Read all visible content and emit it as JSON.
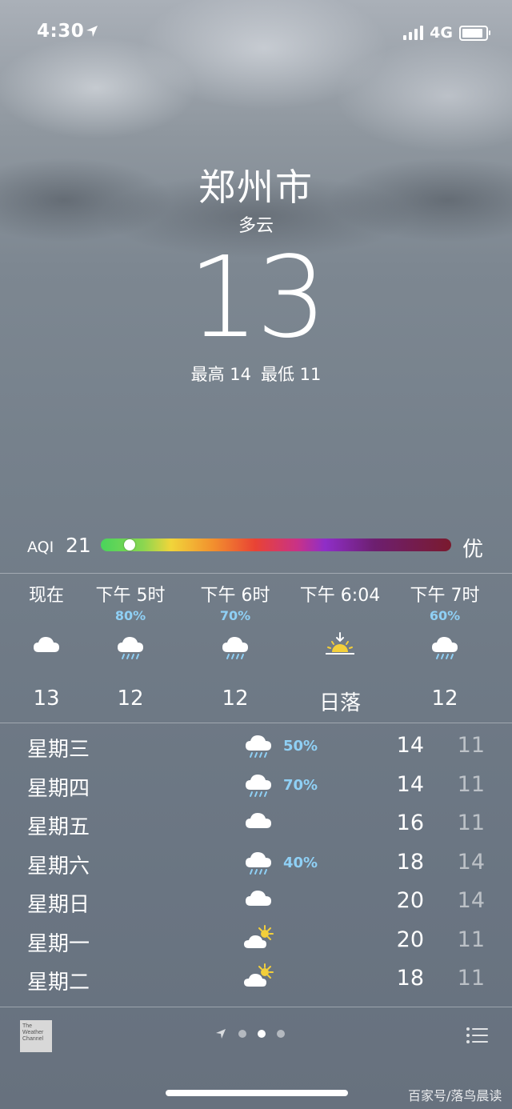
{
  "status_bar": {
    "time": "4:30",
    "network": "4G"
  },
  "header": {
    "city": "郑州市",
    "condition": "多云",
    "temperature": "13",
    "high": "最高 14",
    "low": "最低 11"
  },
  "aqi": {
    "label": "AQI",
    "value": "21",
    "quality": "优",
    "level_fraction": 0.06
  },
  "hourly": [
    {
      "time": "现在",
      "probability": "",
      "icon": "cloud-icon",
      "temp": "13"
    },
    {
      "time": "下午 5时",
      "probability": "80%",
      "icon": "rain-icon",
      "temp": "12"
    },
    {
      "time": "下午 6时",
      "probability": "70%",
      "icon": "rain-icon",
      "temp": "12"
    },
    {
      "time": "下午 6:04",
      "probability": "",
      "icon": "sunset-icon",
      "temp": "日落"
    },
    {
      "time": "下午 7时",
      "probability": "60%",
      "icon": "rain-icon",
      "temp": "12"
    }
  ],
  "daily": [
    {
      "day": "星期三",
      "icon": "rain-icon",
      "probability": "50%",
      "high": "14",
      "low": "11"
    },
    {
      "day": "星期四",
      "icon": "rain-icon",
      "probability": "70%",
      "high": "14",
      "low": "11"
    },
    {
      "day": "星期五",
      "icon": "cloud-icon",
      "probability": "",
      "high": "16",
      "low": "11"
    },
    {
      "day": "星期六",
      "icon": "rain-icon",
      "probability": "40%",
      "high": "18",
      "low": "14"
    },
    {
      "day": "星期日",
      "icon": "cloud-icon",
      "probability": "",
      "high": "20",
      "low": "14"
    },
    {
      "day": "星期一",
      "icon": "partly-sunny-icon",
      "probability": "",
      "high": "20",
      "low": "11"
    },
    {
      "day": "星期二",
      "icon": "partly-sunny-icon",
      "probability": "",
      "high": "18",
      "low": "11"
    }
  ],
  "footer": {
    "logo_text": "The Weather Channel",
    "watermark": "百家号/落鸟晨读"
  },
  "colors": {
    "probability": "#8fd0f5",
    "background_top": "#aab0b8",
    "background_bottom": "#67717e"
  }
}
